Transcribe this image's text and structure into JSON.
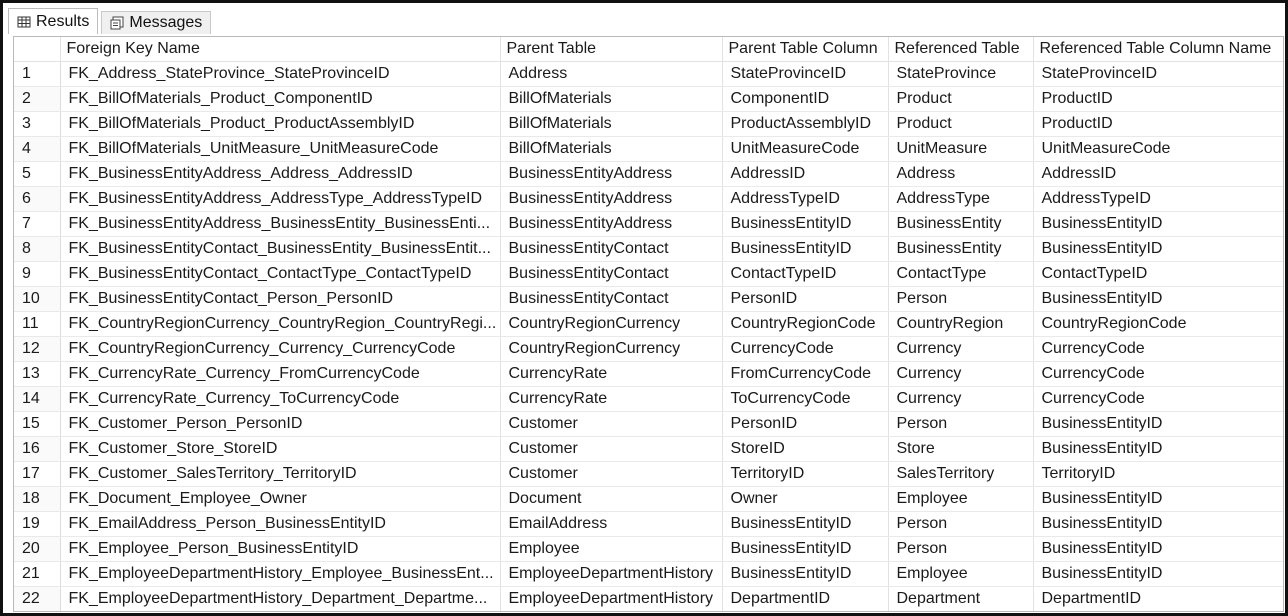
{
  "tabs": [
    {
      "label": "Results",
      "icon": "grid-icon",
      "active": true
    },
    {
      "label": "Messages",
      "icon": "messages-icon",
      "active": false
    }
  ],
  "grid": {
    "columns": [
      "Foreign Key Name",
      "Parent Table",
      "Parent Table Column",
      "Referenced Table",
      "Referenced Table Column Name"
    ],
    "rows": [
      [
        "1",
        "FK_Address_StateProvince_StateProvinceID",
        "Address",
        "StateProvinceID",
        "StateProvince",
        "StateProvinceID"
      ],
      [
        "2",
        "FK_BillOfMaterials_Product_ComponentID",
        "BillOfMaterials",
        "ComponentID",
        "Product",
        "ProductID"
      ],
      [
        "3",
        "FK_BillOfMaterials_Product_ProductAssemblyID",
        "BillOfMaterials",
        "ProductAssemblyID",
        "Product",
        "ProductID"
      ],
      [
        "4",
        "FK_BillOfMaterials_UnitMeasure_UnitMeasureCode",
        "BillOfMaterials",
        "UnitMeasureCode",
        "UnitMeasure",
        "UnitMeasureCode"
      ],
      [
        "5",
        "FK_BusinessEntityAddress_Address_AddressID",
        "BusinessEntityAddress",
        "AddressID",
        "Address",
        "AddressID"
      ],
      [
        "6",
        "FK_BusinessEntityAddress_AddressType_AddressTypeID",
        "BusinessEntityAddress",
        "AddressTypeID",
        "AddressType",
        "AddressTypeID"
      ],
      [
        "7",
        "FK_BusinessEntityAddress_BusinessEntity_BusinessEnti...",
        "BusinessEntityAddress",
        "BusinessEntityID",
        "BusinessEntity",
        "BusinessEntityID"
      ],
      [
        "8",
        "FK_BusinessEntityContact_BusinessEntity_BusinessEntit...",
        "BusinessEntityContact",
        "BusinessEntityID",
        "BusinessEntity",
        "BusinessEntityID"
      ],
      [
        "9",
        "FK_BusinessEntityContact_ContactType_ContactTypeID",
        "BusinessEntityContact",
        "ContactTypeID",
        "ContactType",
        "ContactTypeID"
      ],
      [
        "10",
        "FK_BusinessEntityContact_Person_PersonID",
        "BusinessEntityContact",
        "PersonID",
        "Person",
        "BusinessEntityID"
      ],
      [
        "11",
        "FK_CountryRegionCurrency_CountryRegion_CountryRegi...",
        "CountryRegionCurrency",
        "CountryRegionCode",
        "CountryRegion",
        "CountryRegionCode"
      ],
      [
        "12",
        "FK_CountryRegionCurrency_Currency_CurrencyCode",
        "CountryRegionCurrency",
        "CurrencyCode",
        "Currency",
        "CurrencyCode"
      ],
      [
        "13",
        "FK_CurrencyRate_Currency_FromCurrencyCode",
        "CurrencyRate",
        "FromCurrencyCode",
        "Currency",
        "CurrencyCode"
      ],
      [
        "14",
        "FK_CurrencyRate_Currency_ToCurrencyCode",
        "CurrencyRate",
        "ToCurrencyCode",
        "Currency",
        "CurrencyCode"
      ],
      [
        "15",
        "FK_Customer_Person_PersonID",
        "Customer",
        "PersonID",
        "Person",
        "BusinessEntityID"
      ],
      [
        "16",
        "FK_Customer_Store_StoreID",
        "Customer",
        "StoreID",
        "Store",
        "BusinessEntityID"
      ],
      [
        "17",
        "FK_Customer_SalesTerritory_TerritoryID",
        "Customer",
        "TerritoryID",
        "SalesTerritory",
        "TerritoryID"
      ],
      [
        "18",
        "FK_Document_Employee_Owner",
        "Document",
        "Owner",
        "Employee",
        "BusinessEntityID"
      ],
      [
        "19",
        "FK_EmailAddress_Person_BusinessEntityID",
        "EmailAddress",
        "BusinessEntityID",
        "Person",
        "BusinessEntityID"
      ],
      [
        "20",
        "FK_Employee_Person_BusinessEntityID",
        "Employee",
        "BusinessEntityID",
        "Person",
        "BusinessEntityID"
      ],
      [
        "21",
        "FK_EmployeeDepartmentHistory_Employee_BusinessEnt...",
        "EmployeeDepartmentHistory",
        "BusinessEntityID",
        "Employee",
        "BusinessEntityID"
      ],
      [
        "22",
        "FK_EmployeeDepartmentHistory_Department_Departme...",
        "EmployeeDepartmentHistory",
        "DepartmentID",
        "Department",
        "DepartmentID"
      ]
    ]
  }
}
